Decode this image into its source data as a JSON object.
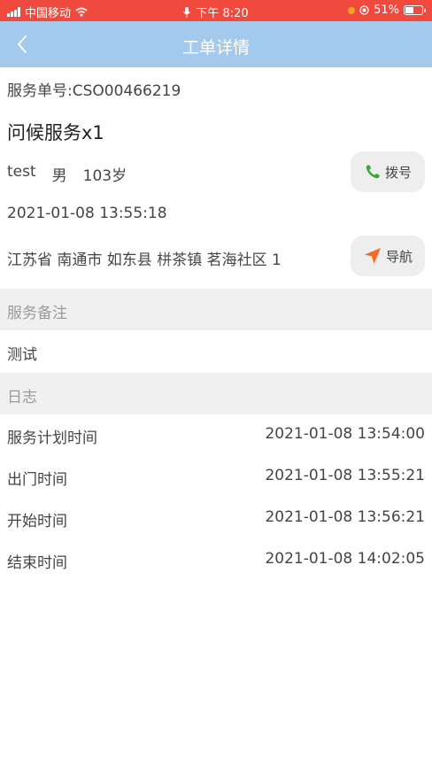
{
  "status_bar": {
    "carrier": "中国移动",
    "time": "下午 8:20",
    "battery": "51%",
    "battery_level": 0.51
  },
  "nav": {
    "title": "工单详情",
    "back_icon": "chevron-left-icon"
  },
  "order": {
    "number_label": "服务单号:CSO00466219",
    "service_title": "问候服务x1",
    "name": "test",
    "gender": "男",
    "age": "103岁",
    "datetime": "2021-01-08 13:55:18",
    "address": "江苏省 南通市 如东县 栟茶镇 茗海社区 1"
  },
  "actions": {
    "dial_label": "拨号",
    "dial_icon": "phone-icon",
    "navigate_label": "导航",
    "navigate_icon": "navigation-arrow-icon"
  },
  "remark": {
    "header": "服务备注",
    "text": "测试"
  },
  "log": {
    "header": "日志",
    "items": [
      {
        "label": "服务计划时间",
        "value": "2021-01-08 13:54:00"
      },
      {
        "label": "出门时间",
        "value": "2021-01-08 13:55:21"
      },
      {
        "label": "开始时间",
        "value": "2021-01-08 13:56:21"
      },
      {
        "label": "结束时间",
        "value": "2021-01-08 14:02:05"
      }
    ]
  },
  "colors": {
    "status_bar": "#f04a3e",
    "nav_bar": "#a3c9ec",
    "phone_icon": "#3aa640",
    "navigate_icon": "#f06a2a"
  }
}
